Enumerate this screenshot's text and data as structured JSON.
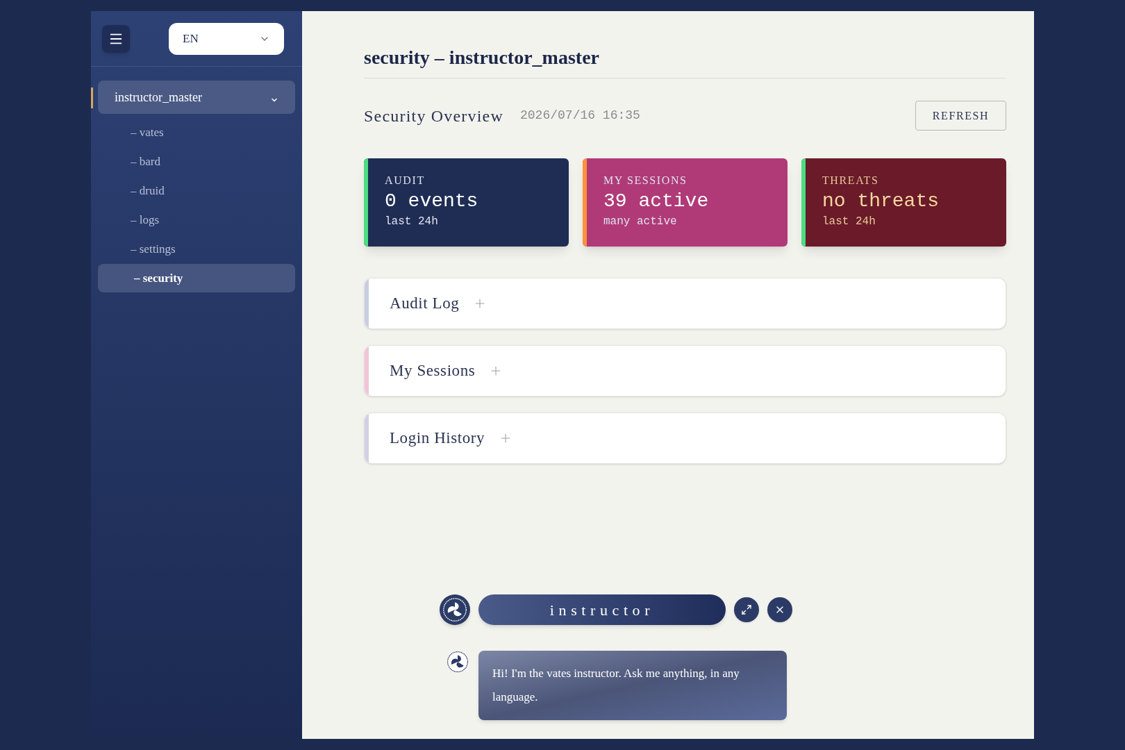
{
  "sidebar": {
    "language": "EN",
    "group": {
      "label": "instructor_master",
      "expanded": true,
      "items": [
        {
          "label": "– vates",
          "selected": false
        },
        {
          "label": "– bard",
          "selected": false
        },
        {
          "label": "– druid",
          "selected": false
        },
        {
          "label": "– logs",
          "selected": false
        },
        {
          "label": "– settings",
          "selected": false
        },
        {
          "label": "– security",
          "selected": true
        }
      ]
    }
  },
  "page": {
    "title": "security – instructor_master",
    "overview": {
      "title": "Security Overview",
      "timestamp": "2026/07/16 16:35",
      "refresh": "REFRESH"
    },
    "cards": [
      {
        "label": "AUDIT",
        "value": "0 events",
        "note": "last 24h",
        "kind": "navy",
        "color": "#4ade80"
      },
      {
        "label": "MY SESSIONS",
        "value": "39 active",
        "note": "many active",
        "kind": "pink",
        "color": "#fb923c"
      },
      {
        "label": "THREATS",
        "value": "no threats",
        "note": "last 24h",
        "kind": "wine",
        "color": "#4ade80"
      }
    ],
    "sections": [
      {
        "title": "Audit Log",
        "expanded": false,
        "color": "#c8cde0"
      },
      {
        "title": "My Sessions",
        "expanded": false,
        "color": "#f2c4d8"
      },
      {
        "title": "Login History",
        "expanded": false,
        "color": "#d4cfe4"
      }
    ]
  },
  "chat": {
    "title": "instructor",
    "messages": [
      {
        "text": "Hi! I'm the vates instructor. Ask me anything, in any language."
      }
    ]
  }
}
